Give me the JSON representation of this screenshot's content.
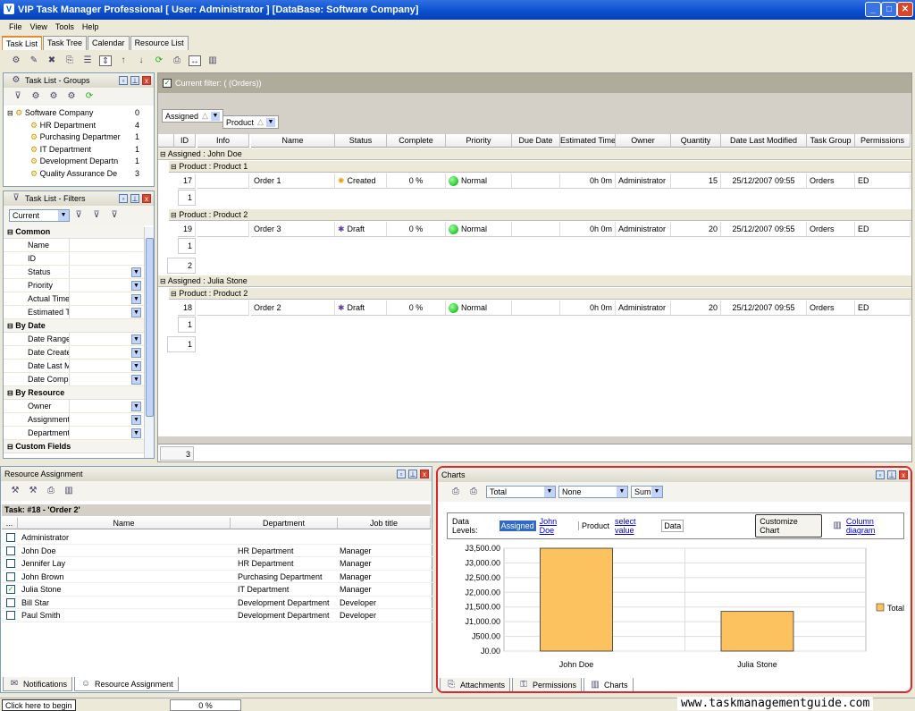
{
  "window": {
    "title": "VIP Task Manager Professional [ User: Administrator ] [DataBase: Software Company]"
  },
  "menu": [
    "File",
    "View",
    "Tools",
    "Help"
  ],
  "main_tabs": [
    "Task List",
    "Task Tree",
    "Calendar",
    "Resource List"
  ],
  "groups_panel": {
    "title": "Task List - Groups",
    "items": [
      {
        "label": "Software Company",
        "count": "0"
      },
      {
        "label": "HR Department",
        "count": "4"
      },
      {
        "label": "Purchasing Departmer",
        "count": "1"
      },
      {
        "label": "IT Department",
        "count": "1"
      },
      {
        "label": "Development Departn",
        "count": "1"
      },
      {
        "label": "Quality Assurance De",
        "count": "3"
      }
    ]
  },
  "filters_panel": {
    "title": "Task List - Filters",
    "current": "Current",
    "sections": [
      {
        "name": "Common",
        "rows": [
          "Name",
          "ID",
          "Status",
          "Priority",
          "Actual Time",
          "Estimated Ti"
        ]
      },
      {
        "name": "By Date",
        "rows": [
          "Date Range",
          "Date Create",
          "Date Last M",
          "Date Compl"
        ]
      },
      {
        "name": "By Resource",
        "rows": [
          "Owner",
          "Assignment",
          "Department"
        ]
      },
      {
        "name": "Custom Fields",
        "rows": []
      }
    ]
  },
  "task_grid": {
    "filter_label": "Current filter:  ( (Orders))",
    "group_chips": [
      "Assigned",
      "Product"
    ],
    "columns": [
      "ID",
      "Info",
      "Name",
      "Status",
      "Complete",
      "Priority",
      "Due Date",
      "Estimated Time",
      "Owner",
      "Quantity",
      "Date Last Modified",
      "Task Group",
      "Permissions"
    ],
    "groups": [
      {
        "label": "Assigned : John Doe",
        "subgroups": [
          {
            "label": "Product : Product 1",
            "rows": [
              {
                "id": "17",
                "name": "Order 1",
                "status": "Created",
                "complete": "0 %",
                "priority": "Normal",
                "est": "0h 0m",
                "owner": "Administrator",
                "qty": "15",
                "modified": "25/12/2007 09:55",
                "group": "Orders",
                "perm": "ED"
              }
            ],
            "count": "1"
          },
          {
            "label": "Product : Product 2",
            "rows": [
              {
                "id": "19",
                "name": "Order 3",
                "status": "Draft",
                "complete": "0 %",
                "priority": "Normal",
                "est": "0h 0m",
                "owner": "Administrator",
                "qty": "20",
                "modified": "25/12/2007 09:55",
                "group": "Orders",
                "perm": "ED"
              }
            ],
            "count": "1"
          }
        ],
        "count": "2"
      },
      {
        "label": "Assigned : Julia Stone",
        "subgroups": [
          {
            "label": "Product : Product 2",
            "rows": [
              {
                "id": "18",
                "name": "Order 2",
                "status": "Draft",
                "complete": "0 %",
                "priority": "Normal",
                "est": "0h 0m",
                "owner": "Administrator",
                "qty": "20",
                "modified": "25/12/2007 09:55",
                "group": "Orders",
                "perm": "ED"
              }
            ],
            "count": "1"
          }
        ],
        "count": "1"
      }
    ],
    "total": "3"
  },
  "resource_panel": {
    "title": "Resource Assignment",
    "task_label": "Task: #18 - 'Order 2'",
    "columns": [
      "...",
      "Name",
      "Department",
      "Job title"
    ],
    "rows": [
      {
        "name": "Administrator",
        "dept": "",
        "job": "",
        "checked": false
      },
      {
        "name": "John Doe",
        "dept": "HR Department",
        "job": "Manager",
        "checked": false
      },
      {
        "name": "Jennifer Lay",
        "dept": "HR Department",
        "job": "Manager",
        "checked": false
      },
      {
        "name": "John Brown",
        "dept": "Purchasing Department",
        "job": "Manager",
        "checked": false
      },
      {
        "name": "Julia Stone",
        "dept": "IT Department",
        "job": "Manager",
        "checked": true
      },
      {
        "name": "Bill Star",
        "dept": "Development Department",
        "job": "Developer",
        "checked": false
      },
      {
        "name": "Paul Smith",
        "dept": "Development Department",
        "job": "Developer",
        "checked": false
      }
    ],
    "tabs": [
      "Notifications",
      "Resource Assignment"
    ]
  },
  "charts_panel": {
    "title": "Charts",
    "combo_total": "Total",
    "combo_none": "None",
    "combo_sum": "Sum",
    "data_levels_label": "Data Levels:",
    "level_assigned": "Assigned",
    "level_john": "John Doe",
    "level_product": "Product",
    "level_select": "select value",
    "level_data": "Data",
    "customize": "Customize Chart",
    "column_diagram": "Column diagram",
    "tabs": [
      "Attachments",
      "Permissions",
      "Charts"
    ]
  },
  "chart_data": {
    "type": "bar",
    "categories": [
      "John Doe",
      "Julia Stone"
    ],
    "series": [
      {
        "name": "Total",
        "values": [
          3500,
          1350
        ]
      }
    ],
    "ylim": [
      0,
      3500
    ],
    "yticks": [
      "J0.00",
      "J500.00",
      "J1,000.00",
      "J1,500.00",
      "J2,000.00",
      "J2,500.00",
      "J3,000.00",
      "J3,500.00"
    ],
    "legend": "right",
    "bar_color": "#fbc25f"
  },
  "status": {
    "hint": "Click here to begin",
    "progress": "0 %",
    "watermark": "www.taskmanagementguide.com"
  }
}
